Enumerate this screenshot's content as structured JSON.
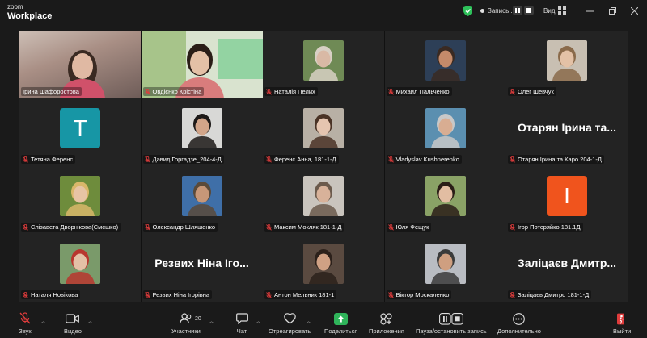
{
  "app": {
    "logo_line1": "zoom",
    "logo_line2": "Workplace",
    "recording_label": "Запись...",
    "view_label": "Вид"
  },
  "participants": [
    {
      "name": "Ірина Шафоростова",
      "kind": "video1"
    },
    {
      "name": "Овдієнко Крістіна",
      "kind": "video2"
    },
    {
      "name": "Наталія Пелих",
      "kind": "photo",
      "bg": "#6f8a55",
      "face": "#d9b9a5",
      "hair": "#d8d0c4"
    },
    {
      "name": "Михаил Пальченко",
      "kind": "photo",
      "bg": "#2d3f57",
      "face": "#c48a6a",
      "hair": "#3a2a22"
    },
    {
      "name": "Олег Шевчук",
      "kind": "photo",
      "bg": "#c8bfb2",
      "face": "#e3c1a6",
      "hair": "#8a6a4a"
    },
    {
      "name": "Тетяна Ференс",
      "kind": "letter",
      "letter": "T",
      "color": "#1796a5"
    },
    {
      "name": "Давид Горгадзе_204-4-Д",
      "kind": "photo",
      "bg": "#d8d8d6",
      "face": "#d2a589",
      "hair": "#1d1a18"
    },
    {
      "name": "Ференс Анна, 181-1-Д",
      "kind": "photo",
      "bg": "#b8b0a5",
      "face": "#e5c5b0",
      "hair": "#4a3326"
    },
    {
      "name": "Vladyslav Kushnerenko",
      "kind": "photo",
      "bg": "#5b8fb0",
      "face": "#d8ad92",
      "hair": "#c8c8c8"
    },
    {
      "name": "Отарян Ірина та Каро 204-1-Д",
      "kind": "bigname",
      "big": "Отарян Ірина та..."
    },
    {
      "name": "Єлізавета Дворнікова(Смєшко)",
      "kind": "photo",
      "bg": "#6e8c3c",
      "face": "#e7c4a5",
      "hair": "#d9b76a"
    },
    {
      "name": "Олександр Шляшенко",
      "kind": "photo",
      "bg": "#3f6fa8",
      "face": "#c79778",
      "hair": "#5a4a3a"
    },
    {
      "name": "Максим Мокляк 181-1-Д",
      "kind": "photo",
      "bg": "#c9c4bd",
      "face": "#d8b29a",
      "hair": "#6b5a4c"
    },
    {
      "name": "Юля Фещук",
      "kind": "photo",
      "bg": "#8aa266",
      "face": "#e2bda2",
      "hair": "#2a1d17"
    },
    {
      "name": "Ігор Потєряйко 181.1Д",
      "kind": "letter",
      "letter": "I",
      "color": "#f0541d"
    },
    {
      "name": "Наталя Новікова",
      "kind": "photo",
      "bg": "#7a9a6a",
      "face": "#e4c0a6",
      "hair": "#b8362e"
    },
    {
      "name": "Резвих Ніна Ігорівна",
      "kind": "bigname",
      "big": "Резвих Ніна Іго..."
    },
    {
      "name": "Антон Мельник  181-1",
      "kind": "photo",
      "bg": "#5a4a40",
      "face": "#d0a184",
      "hair": "#2c211b"
    },
    {
      "name": "Віктор Москаленко",
      "kind": "photo",
      "bg": "#b9bcc2",
      "face": "#cf9f80",
      "hair": "#3b3b3b"
    },
    {
      "name": "Заліцаєв Дмитро 181-1-Д",
      "kind": "bigname",
      "big": "Заліцаєв Дмитр..."
    }
  ],
  "toolbar": {
    "audio": "Звук",
    "video": "Видео",
    "participants": "Участники",
    "participants_count": "20",
    "chat": "Чат",
    "react": "Отреагировать",
    "share": "Поделиться",
    "apps": "Приложения",
    "pause_record": "Пауза/остановить запись",
    "more": "Дополнительно",
    "leave": "Выйти"
  },
  "colors": {
    "accent_green": "#2ee07a",
    "share_green": "#2fb45a",
    "mute_red": "#e03c3c",
    "background": "#1a1a1a"
  }
}
